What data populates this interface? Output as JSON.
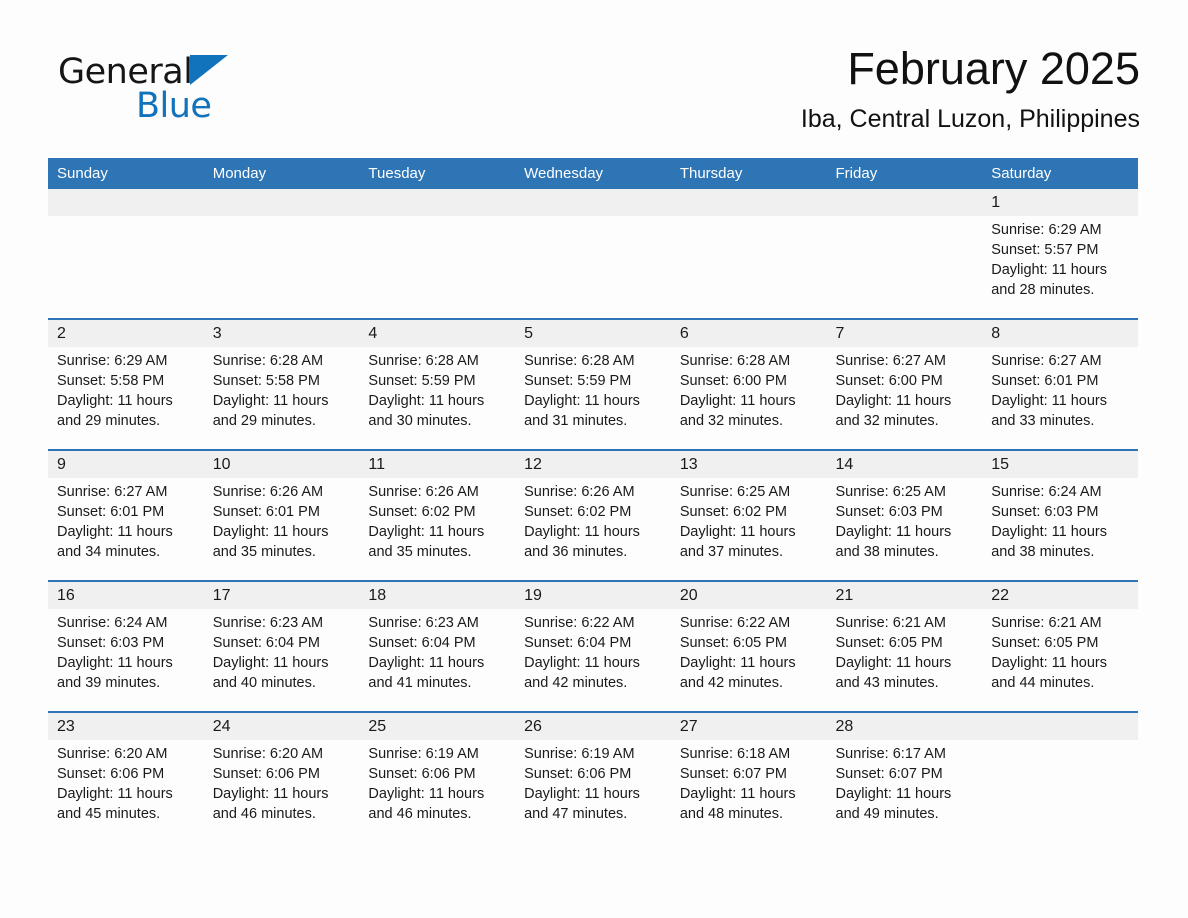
{
  "brand": {
    "word1": "General",
    "word2": "Blue",
    "triangle_color": "#1273bd"
  },
  "header": {
    "month_title": "February 2025",
    "location": "Iba, Central Luzon, Philippines"
  },
  "theme": {
    "header_blue": "#2e75b6",
    "daynum_band": "#f0f0f0",
    "page_background": "#fdfdfd",
    "text": "#1a1a1a"
  },
  "calendar": {
    "weekday_headers": [
      "Sunday",
      "Monday",
      "Tuesday",
      "Wednesday",
      "Thursday",
      "Friday",
      "Saturday"
    ],
    "weeks": [
      {
        "days": [
          {
            "num": "",
            "sunrise": "",
            "sunset": "",
            "daylight1": "",
            "daylight2": ""
          },
          {
            "num": "",
            "sunrise": "",
            "sunset": "",
            "daylight1": "",
            "daylight2": ""
          },
          {
            "num": "",
            "sunrise": "",
            "sunset": "",
            "daylight1": "",
            "daylight2": ""
          },
          {
            "num": "",
            "sunrise": "",
            "sunset": "",
            "daylight1": "",
            "daylight2": ""
          },
          {
            "num": "",
            "sunrise": "",
            "sunset": "",
            "daylight1": "",
            "daylight2": ""
          },
          {
            "num": "",
            "sunrise": "",
            "sunset": "",
            "daylight1": "",
            "daylight2": ""
          },
          {
            "num": "1",
            "sunrise": "Sunrise: 6:29 AM",
            "sunset": "Sunset: 5:57 PM",
            "daylight1": "Daylight: 11 hours",
            "daylight2": "and 28 minutes."
          }
        ]
      },
      {
        "days": [
          {
            "num": "2",
            "sunrise": "Sunrise: 6:29 AM",
            "sunset": "Sunset: 5:58 PM",
            "daylight1": "Daylight: 11 hours",
            "daylight2": "and 29 minutes."
          },
          {
            "num": "3",
            "sunrise": "Sunrise: 6:28 AM",
            "sunset": "Sunset: 5:58 PM",
            "daylight1": "Daylight: 11 hours",
            "daylight2": "and 29 minutes."
          },
          {
            "num": "4",
            "sunrise": "Sunrise: 6:28 AM",
            "sunset": "Sunset: 5:59 PM",
            "daylight1": "Daylight: 11 hours",
            "daylight2": "and 30 minutes."
          },
          {
            "num": "5",
            "sunrise": "Sunrise: 6:28 AM",
            "sunset": "Sunset: 5:59 PM",
            "daylight1": "Daylight: 11 hours",
            "daylight2": "and 31 minutes."
          },
          {
            "num": "6",
            "sunrise": "Sunrise: 6:28 AM",
            "sunset": "Sunset: 6:00 PM",
            "daylight1": "Daylight: 11 hours",
            "daylight2": "and 32 minutes."
          },
          {
            "num": "7",
            "sunrise": "Sunrise: 6:27 AM",
            "sunset": "Sunset: 6:00 PM",
            "daylight1": "Daylight: 11 hours",
            "daylight2": "and 32 minutes."
          },
          {
            "num": "8",
            "sunrise": "Sunrise: 6:27 AM",
            "sunset": "Sunset: 6:01 PM",
            "daylight1": "Daylight: 11 hours",
            "daylight2": "and 33 minutes."
          }
        ]
      },
      {
        "days": [
          {
            "num": "9",
            "sunrise": "Sunrise: 6:27 AM",
            "sunset": "Sunset: 6:01 PM",
            "daylight1": "Daylight: 11 hours",
            "daylight2": "and 34 minutes."
          },
          {
            "num": "10",
            "sunrise": "Sunrise: 6:26 AM",
            "sunset": "Sunset: 6:01 PM",
            "daylight1": "Daylight: 11 hours",
            "daylight2": "and 35 minutes."
          },
          {
            "num": "11",
            "sunrise": "Sunrise: 6:26 AM",
            "sunset": "Sunset: 6:02 PM",
            "daylight1": "Daylight: 11 hours",
            "daylight2": "and 35 minutes."
          },
          {
            "num": "12",
            "sunrise": "Sunrise: 6:26 AM",
            "sunset": "Sunset: 6:02 PM",
            "daylight1": "Daylight: 11 hours",
            "daylight2": "and 36 minutes."
          },
          {
            "num": "13",
            "sunrise": "Sunrise: 6:25 AM",
            "sunset": "Sunset: 6:02 PM",
            "daylight1": "Daylight: 11 hours",
            "daylight2": "and 37 minutes."
          },
          {
            "num": "14",
            "sunrise": "Sunrise: 6:25 AM",
            "sunset": "Sunset: 6:03 PM",
            "daylight1": "Daylight: 11 hours",
            "daylight2": "and 38 minutes."
          },
          {
            "num": "15",
            "sunrise": "Sunrise: 6:24 AM",
            "sunset": "Sunset: 6:03 PM",
            "daylight1": "Daylight: 11 hours",
            "daylight2": "and 38 minutes."
          }
        ]
      },
      {
        "days": [
          {
            "num": "16",
            "sunrise": "Sunrise: 6:24 AM",
            "sunset": "Sunset: 6:03 PM",
            "daylight1": "Daylight: 11 hours",
            "daylight2": "and 39 minutes."
          },
          {
            "num": "17",
            "sunrise": "Sunrise: 6:23 AM",
            "sunset": "Sunset: 6:04 PM",
            "daylight1": "Daylight: 11 hours",
            "daylight2": "and 40 minutes."
          },
          {
            "num": "18",
            "sunrise": "Sunrise: 6:23 AM",
            "sunset": "Sunset: 6:04 PM",
            "daylight1": "Daylight: 11 hours",
            "daylight2": "and 41 minutes."
          },
          {
            "num": "19",
            "sunrise": "Sunrise: 6:22 AM",
            "sunset": "Sunset: 6:04 PM",
            "daylight1": "Daylight: 11 hours",
            "daylight2": "and 42 minutes."
          },
          {
            "num": "20",
            "sunrise": "Sunrise: 6:22 AM",
            "sunset": "Sunset: 6:05 PM",
            "daylight1": "Daylight: 11 hours",
            "daylight2": "and 42 minutes."
          },
          {
            "num": "21",
            "sunrise": "Sunrise: 6:21 AM",
            "sunset": "Sunset: 6:05 PM",
            "daylight1": "Daylight: 11 hours",
            "daylight2": "and 43 minutes."
          },
          {
            "num": "22",
            "sunrise": "Sunrise: 6:21 AM",
            "sunset": "Sunset: 6:05 PM",
            "daylight1": "Daylight: 11 hours",
            "daylight2": "and 44 minutes."
          }
        ]
      },
      {
        "days": [
          {
            "num": "23",
            "sunrise": "Sunrise: 6:20 AM",
            "sunset": "Sunset: 6:06 PM",
            "daylight1": "Daylight: 11 hours",
            "daylight2": "and 45 minutes."
          },
          {
            "num": "24",
            "sunrise": "Sunrise: 6:20 AM",
            "sunset": "Sunset: 6:06 PM",
            "daylight1": "Daylight: 11 hours",
            "daylight2": "and 46 minutes."
          },
          {
            "num": "25",
            "sunrise": "Sunrise: 6:19 AM",
            "sunset": "Sunset: 6:06 PM",
            "daylight1": "Daylight: 11 hours",
            "daylight2": "and 46 minutes."
          },
          {
            "num": "26",
            "sunrise": "Sunrise: 6:19 AM",
            "sunset": "Sunset: 6:06 PM",
            "daylight1": "Daylight: 11 hours",
            "daylight2": "and 47 minutes."
          },
          {
            "num": "27",
            "sunrise": "Sunrise: 6:18 AM",
            "sunset": "Sunset: 6:07 PM",
            "daylight1": "Daylight: 11 hours",
            "daylight2": "and 48 minutes."
          },
          {
            "num": "28",
            "sunrise": "Sunrise: 6:17 AM",
            "sunset": "Sunset: 6:07 PM",
            "daylight1": "Daylight: 11 hours",
            "daylight2": "and 49 minutes."
          },
          {
            "num": "",
            "sunrise": "",
            "sunset": "",
            "daylight1": "",
            "daylight2": ""
          }
        ]
      }
    ]
  }
}
